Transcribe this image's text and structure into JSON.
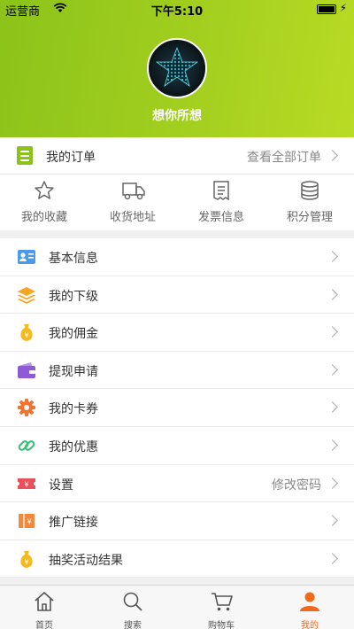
{
  "status_bar": {
    "carrier": "运营商",
    "time": "下午5:10"
  },
  "profile": {
    "username": "想你所想"
  },
  "orders": {
    "title": "我的订单",
    "view_all": "查看全部订单",
    "shortcuts": [
      {
        "label": "我的收藏",
        "icon": "star-icon"
      },
      {
        "label": "收货地址",
        "icon": "truck-icon"
      },
      {
        "label": "发票信息",
        "icon": "invoice-icon"
      },
      {
        "label": "积分管理",
        "icon": "coins-stack-icon"
      }
    ]
  },
  "menu": [
    {
      "label": "基本信息",
      "icon": "id-card-icon",
      "color": "#4a9be8"
    },
    {
      "label": "我的下级",
      "icon": "layers-icon",
      "color": "#f5a623"
    },
    {
      "label": "我的佣金",
      "icon": "money-bag-icon",
      "color": "#f5b920"
    },
    {
      "label": "提现申请",
      "icon": "wallet-icon",
      "color": "#8e5ad6"
    },
    {
      "label": "我的卡券",
      "icon": "gear-icon",
      "color": "#f0742f"
    },
    {
      "label": "我的优惠",
      "icon": "link-icon",
      "color": "#3fbf7a"
    },
    {
      "label": "设置",
      "value": "修改密码",
      "icon": "ticket-icon",
      "color": "#e8505b"
    },
    {
      "label": "推广链接",
      "icon": "coupon-icon",
      "color": "#f08a3c"
    },
    {
      "label": "抽奖活动结果",
      "icon": "money-bag-icon",
      "color": "#f5b920"
    }
  ],
  "tabbar": [
    {
      "label": "首页",
      "icon": "home-icon"
    },
    {
      "label": "搜索",
      "icon": "search-icon"
    },
    {
      "label": "购物车",
      "icon": "cart-icon"
    },
    {
      "label": "我的",
      "icon": "user-icon",
      "active": true
    }
  ],
  "colors": {
    "accent": "#8cc31a",
    "active_tab": "#f06a1b"
  }
}
